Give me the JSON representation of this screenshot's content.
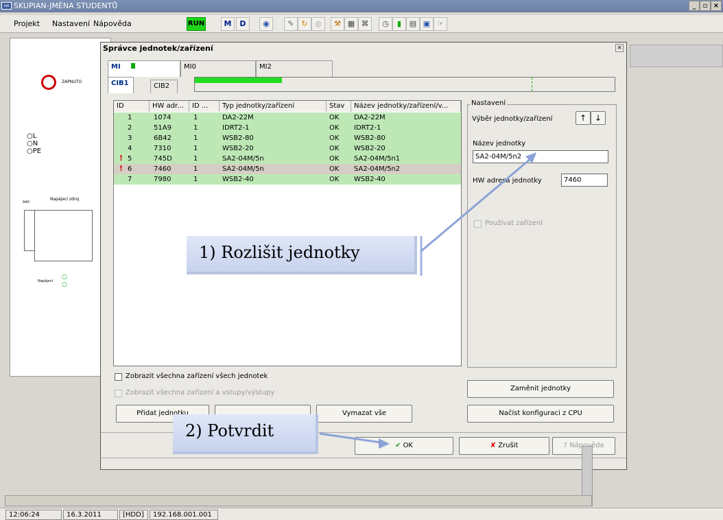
{
  "app": {
    "title": "SKUPIAN-JMÉNA STUDENTŮ"
  },
  "menu": {
    "items": [
      "Projekt",
      "Nastavení",
      "Nápověda"
    ],
    "run_label": "RUN",
    "m_label": "M",
    "d_label": "D"
  },
  "left_panel": {
    "zapnuto": "ZAPNUTO",
    "radio_labels": [
      "L",
      "N",
      "PE"
    ],
    "section_label": "Napájecí zdroj",
    "small_label": "A40",
    "napajeni_label": "Napájení"
  },
  "dialog": {
    "title": "Správce jednotek/zařízení",
    "tabs_top": [
      "MI",
      "MI0",
      "MI2"
    ],
    "tabs_bottom": [
      "CIB1",
      "CIB2"
    ],
    "columns": [
      "ID",
      "HW adr...",
      "ID ...",
      "Typ jednotky/zařízení",
      "Stav",
      "Název jednotky/zařízení/v..."
    ],
    "rows": [
      {
        "id": "1",
        "hw": "1074",
        "id2": "1",
        "type": "DA2-22M",
        "state": "OK",
        "name": "DA2-22M",
        "warn": false
      },
      {
        "id": "2",
        "hw": "51A9",
        "id2": "1",
        "type": "IDRT2-1",
        "state": "OK",
        "name": "IDRT2-1",
        "warn": false
      },
      {
        "id": "3",
        "hw": "6B42",
        "id2": "1",
        "type": "WSB2-80",
        "state": "OK",
        "name": "WSB2-80",
        "warn": false
      },
      {
        "id": "4",
        "hw": "7310",
        "id2": "1",
        "type": "WSB2-20",
        "state": "OK",
        "name": "WSB2-20",
        "warn": false
      },
      {
        "id": "5",
        "hw": "745D",
        "id2": "1",
        "type": "SA2-04M/5n",
        "state": "OK",
        "name": "SA2-04M/5n1",
        "warn": true
      },
      {
        "id": "6",
        "hw": "7460",
        "id2": "1",
        "type": "SA2-04M/5n",
        "state": "OK",
        "name": "SA2-04M/5n2",
        "warn": true
      },
      {
        "id": "7",
        "hw": "7980",
        "id2": "1",
        "type": "WSB2-40",
        "state": "OK",
        "name": "WSB2-40",
        "warn": false
      }
    ],
    "selected_row": 6,
    "settings": {
      "group_label": "Nastavení",
      "select_label": "Výběr jednotky/zařízení",
      "unit_name_label": "Název jednotky",
      "unit_name_value": "SA2-04M/5n2",
      "hw_label": "HW adresa jednotky",
      "hw_value": "7460",
      "use_device_label": "Používat zařízení"
    },
    "checkbox_all": "Zobrazit všechna zařízení všech jednotek",
    "checkbox_io": "Zobrazit všechna zařízení a vstupy/výstupy",
    "buttons": {
      "add": "Přidat jednotku",
      "delete_all": "Vymazat vše",
      "replace": "Zaměnit jednotky",
      "load": "Načíst konfiguraci z CPU",
      "ok": "OK",
      "cancel": "Zrušit",
      "help": "Nápověda"
    }
  },
  "callouts": {
    "one": "1) Rozlišit jednotky",
    "two": "2) Potvrdit"
  },
  "status": {
    "time": "12:06:24",
    "date": "16.3.2011",
    "mode": "[HDD]",
    "ip": "192.168.001.001"
  },
  "colors": {
    "row_green": "#bde8b6",
    "run_green": "#1fd41a",
    "progress_green": "#22dd22"
  }
}
